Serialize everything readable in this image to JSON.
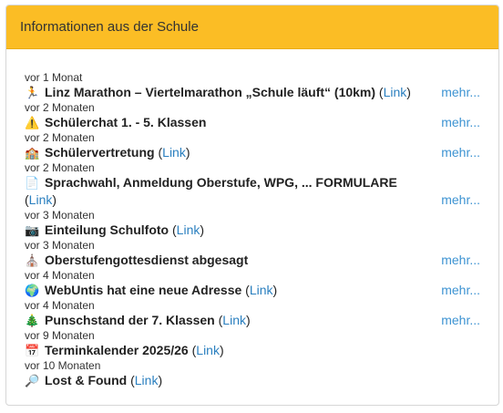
{
  "header": {
    "title": "Informationen aus der Schule"
  },
  "more_label": "mehr...",
  "items": [
    {
      "date": "vor 1 Monat",
      "icon": "runner-icon",
      "glyph": "🏃",
      "title": "Linz Marathon – Viertelmarathon „Schule läuft“ (10km)",
      "link": "Link",
      "more": true
    },
    {
      "date": "vor 2 Monaten",
      "icon": "warning-icon",
      "glyph": "⚠️",
      "title": "Schülerchat 1. - 5. Klassen",
      "link": null,
      "more": true
    },
    {
      "date": "vor 2 Monaten",
      "icon": "school-icon",
      "glyph": "🏫",
      "title": "Schülervertretung",
      "link": "Link",
      "more": true
    },
    {
      "date": "vor 2 Monaten",
      "icon": "document-icon",
      "glyph": "📄",
      "title": "Sprachwahl, Anmeldung Oberstufe, WPG, ... FORMULARE",
      "link": "Link",
      "more": true
    },
    {
      "date": "vor 3 Monaten",
      "icon": "camera-icon",
      "glyph": "📷",
      "title": "Einteilung Schulfoto",
      "link": "Link",
      "more": false
    },
    {
      "date": "vor 3 Monaten",
      "icon": "church-icon",
      "glyph": "⛪",
      "title": "Oberstufengottesdienst abgesagt",
      "link": null,
      "more": true
    },
    {
      "date": "vor 4 Monaten",
      "icon": "globe-icon",
      "glyph": "🌍",
      "title": "WebUntis hat eine neue Adresse",
      "link": "Link",
      "more": true
    },
    {
      "date": "vor 4 Monaten",
      "icon": "tree-icon",
      "glyph": "🎄",
      "title": "Punschstand der 7. Klassen",
      "link": "Link",
      "more": true
    },
    {
      "date": "vor 9 Monaten",
      "icon": "calendar-icon",
      "glyph": "📅",
      "title": "Terminkalender 2025/26",
      "link": "Link",
      "more": false
    },
    {
      "date": "vor 10 Monaten",
      "icon": "magnifier-icon",
      "glyph": "🔎",
      "title": "Lost & Found",
      "link": "Link",
      "more": false
    }
  ]
}
